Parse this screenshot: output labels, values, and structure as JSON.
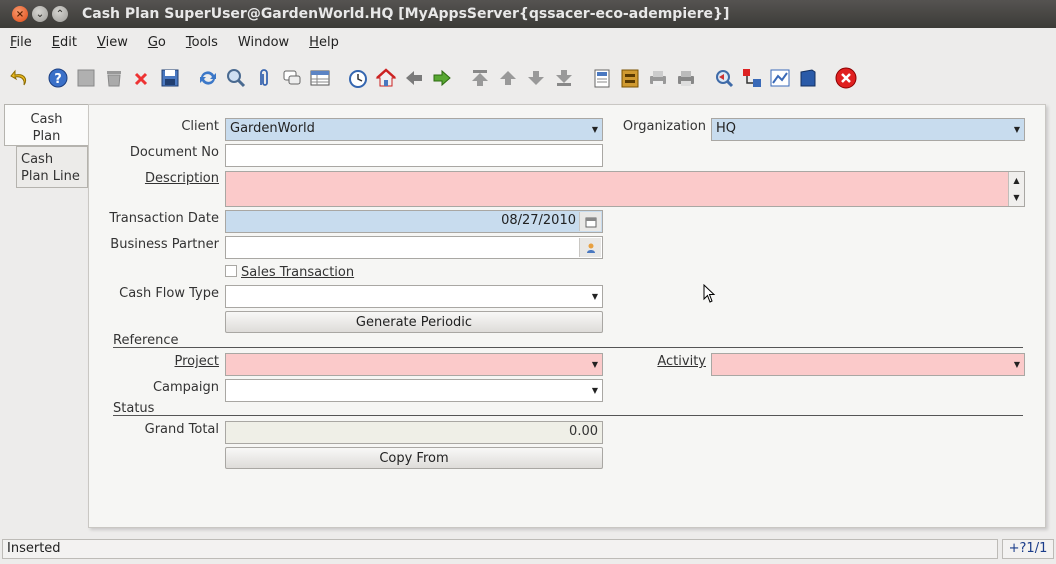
{
  "window": {
    "title": "Cash Plan  SuperUser@GardenWorld.HQ [MyAppsServer{qssacer-eco-adempiere}]"
  },
  "menu": [
    {
      "mnemonic": "F",
      "rest": "ile"
    },
    {
      "mnemonic": "E",
      "rest": "dit"
    },
    {
      "mnemonic": "V",
      "rest": "iew"
    },
    {
      "mnemonic": "G",
      "rest": "o"
    },
    {
      "mnemonic": "T",
      "rest": "ools"
    },
    {
      "mnemonic": "",
      "rest": "Window"
    },
    {
      "mnemonic": "H",
      "rest": "elp"
    }
  ],
  "tabs": [
    {
      "label": "Cash\nPlan"
    },
    {
      "label": "Cash\nPlan Line"
    }
  ],
  "form": {
    "client": {
      "label": "Client",
      "value": "GardenWorld"
    },
    "organization": {
      "label": "Organization",
      "value": "HQ"
    },
    "document_no": {
      "label": "Document No",
      "value": ""
    },
    "description": {
      "label": "Description",
      "value": ""
    },
    "transaction_date": {
      "label": "Transaction Date",
      "value": "08/27/2010"
    },
    "business_partner": {
      "label": "Business Partner",
      "value": ""
    },
    "sales_transaction": {
      "label": "Sales Transaction",
      "checked": false
    },
    "cash_flow_type": {
      "label": "Cash Flow Type",
      "value": ""
    },
    "generate_periodic": {
      "label": "Generate Periodic"
    },
    "reference_section": "Reference",
    "project": {
      "label": "Project",
      "value": ""
    },
    "activity": {
      "label": "Activity",
      "value": ""
    },
    "campaign": {
      "label": "Campaign",
      "value": ""
    },
    "status_section": "Status",
    "grand_total": {
      "label": "Grand Total",
      "value": "0.00"
    },
    "copy_from": {
      "label": "Copy From"
    }
  },
  "status": {
    "message": "Inserted",
    "record": "+?1/1"
  },
  "colors": {
    "mandatory": "#fbcaca",
    "readonly": "#c8dcee",
    "titlebar": "#3c3b37"
  }
}
